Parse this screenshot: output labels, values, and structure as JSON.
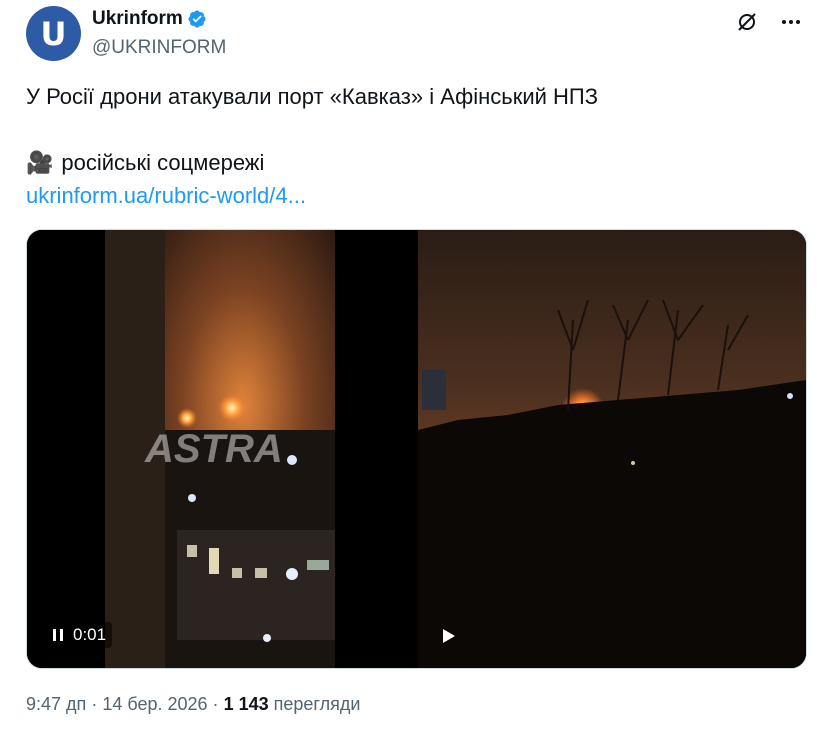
{
  "account": {
    "display_name": "Ukrinform",
    "handle": "@UKRINFORM",
    "avatar_letter": "U",
    "avatar_color": "#2e5ba6",
    "verified": true
  },
  "tweet": {
    "text_line1": "У Росії дрони атакували порт «Кавказ» і Афінський НПЗ",
    "text_line2": "російські соцмережі",
    "text_line2_icon": "film-camera-icon",
    "link_text": "ukrinform.ua/rubric-world/4..."
  },
  "media": {
    "video_left": {
      "watermark": "ASTRA",
      "timestamp": "0:01",
      "state": "playing"
    },
    "video_right": {
      "state": "paused"
    }
  },
  "meta": {
    "time": "9:47 дп",
    "date": "14 бер. 2026",
    "views_count": "1 143",
    "views_label": "перегляди",
    "separator": "·"
  },
  "colors": {
    "link": "#1d9bf0",
    "secondary_text": "#536471",
    "primary_text": "#0f1419"
  },
  "icons": {
    "top_right": [
      "grok-icon",
      "more-icon"
    ]
  }
}
